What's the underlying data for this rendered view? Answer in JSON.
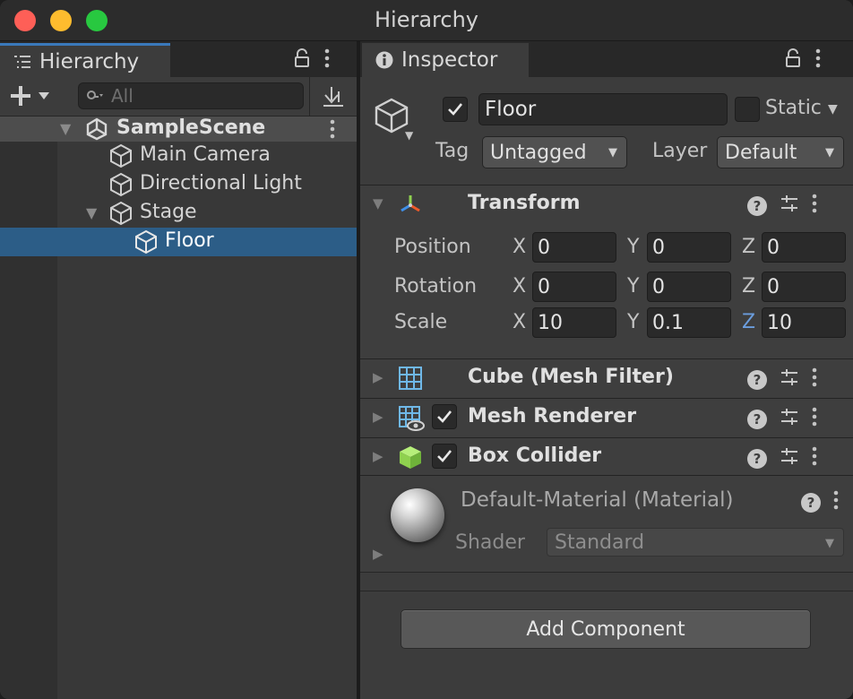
{
  "window": {
    "title": "Hierarchy"
  },
  "hierarchy": {
    "tab_label": "Hierarchy",
    "search_placeholder": "All",
    "scene": "SampleScene",
    "items": [
      {
        "label": "Main Camera"
      },
      {
        "label": "Directional Light"
      },
      {
        "label": "Stage"
      },
      {
        "label": "Floor"
      }
    ]
  },
  "inspector": {
    "tab_label": "Inspector",
    "object_name": "Floor",
    "static_label": "Static",
    "tag_label": "Tag",
    "tag_value": "Untagged",
    "layer_label": "Layer",
    "layer_value": "Default",
    "transform": {
      "title": "Transform",
      "position_label": "Position",
      "rotation_label": "Rotation",
      "scale_label": "Scale",
      "axis_x": "X",
      "axis_y": "Y",
      "axis_z": "Z",
      "position": {
        "x": "0",
        "y": "0",
        "z": "0"
      },
      "rotation": {
        "x": "0",
        "y": "0",
        "z": "0"
      },
      "scale": {
        "x": "10",
        "y": "0.1",
        "z": "10"
      }
    },
    "components": [
      {
        "name": "Cube (Mesh Filter)"
      },
      {
        "name": "Mesh Renderer"
      },
      {
        "name": "Box Collider"
      }
    ],
    "material": {
      "name": "Default-Material (Material)",
      "shader_label": "Shader",
      "shader_value": "Standard"
    },
    "add_component_label": "Add Component",
    "help_glyph": "?"
  },
  "colors": {
    "selection": "#2c5d87",
    "accent_tab": "#3a79bb",
    "collider_green": "#8fd14f",
    "grid_blue": "#6fb8e8"
  }
}
